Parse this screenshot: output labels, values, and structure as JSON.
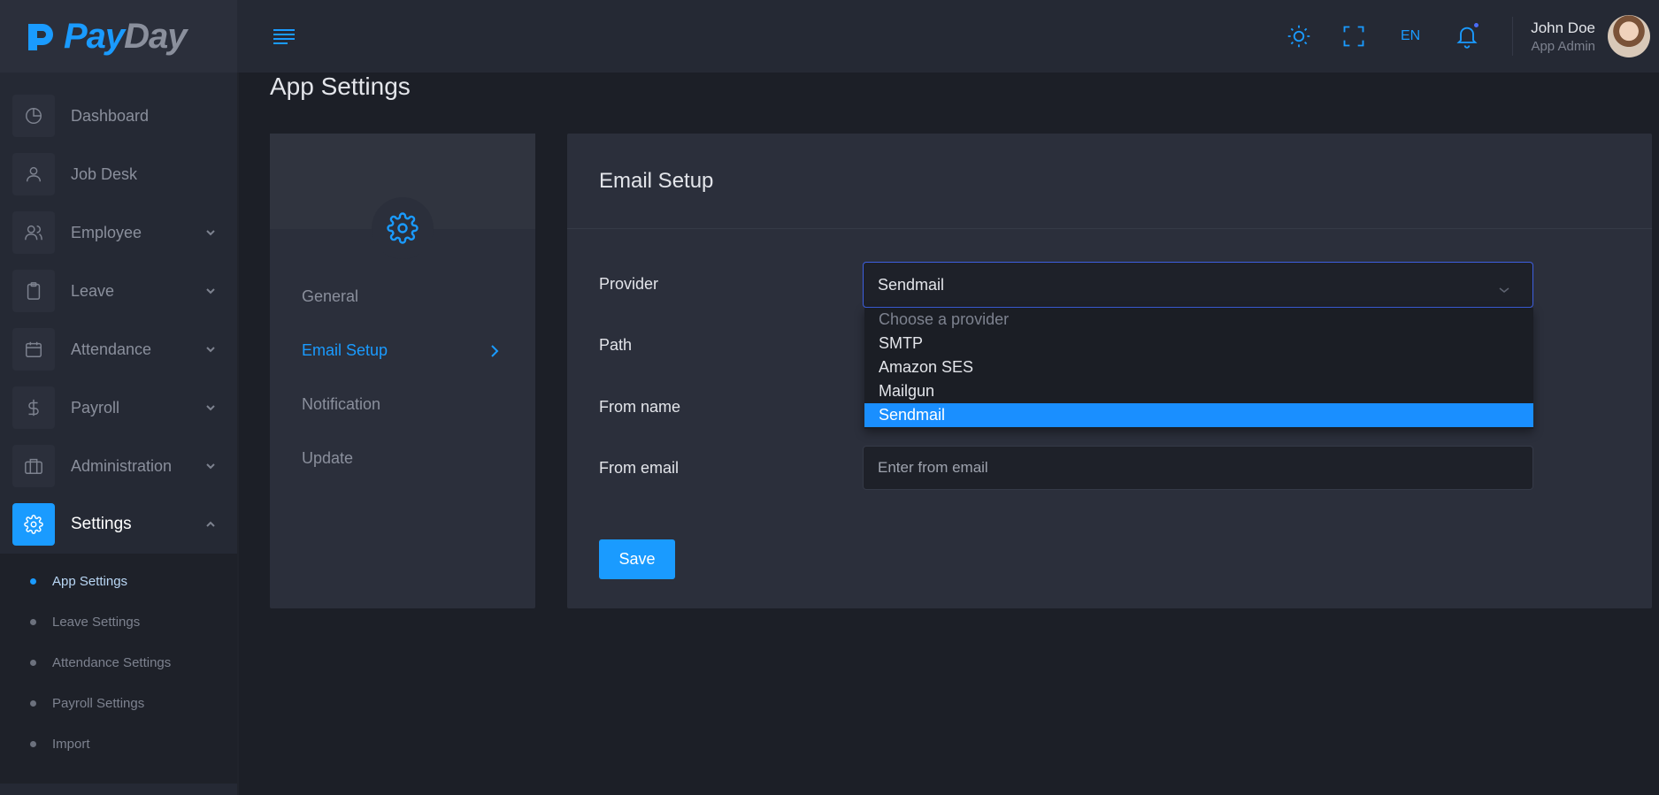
{
  "brand": {
    "pay": "Pay",
    "day": "Day"
  },
  "sidebar": {
    "items": [
      {
        "label": "Dashboard",
        "icon": "pie-chart-icon"
      },
      {
        "label": "Job Desk",
        "icon": "user-icon"
      },
      {
        "label": "Employee",
        "icon": "users-icon"
      },
      {
        "label": "Leave",
        "icon": "clipboard-icon"
      },
      {
        "label": "Attendance",
        "icon": "calendar-icon"
      },
      {
        "label": "Payroll",
        "icon": "dollar-icon"
      },
      {
        "label": "Administration",
        "icon": "briefcase-icon"
      },
      {
        "label": "Settings",
        "icon": "gear-icon"
      }
    ],
    "subitems": [
      {
        "label": "App Settings"
      },
      {
        "label": "Leave Settings"
      },
      {
        "label": "Attendance Settings"
      },
      {
        "label": "Payroll Settings"
      },
      {
        "label": "Import"
      }
    ]
  },
  "header": {
    "lang": "EN",
    "user_name": "John Doe",
    "user_role": "App Admin"
  },
  "page": {
    "title": "App Settings"
  },
  "settings_menu": {
    "items": [
      {
        "label": "General"
      },
      {
        "label": "Email Setup"
      },
      {
        "label": "Notification"
      },
      {
        "label": "Update"
      }
    ]
  },
  "panel": {
    "title": "Email Setup",
    "provider_label": "Provider",
    "provider_value": "Sendmail",
    "path_label": "Path",
    "from_name_label": "From name",
    "from_email_label": "From email",
    "from_email_placeholder": "Enter from email",
    "save_label": "Save",
    "options": [
      {
        "label": "Choose a provider"
      },
      {
        "label": "SMTP"
      },
      {
        "label": "Amazon SES"
      },
      {
        "label": "Mailgun"
      },
      {
        "label": "Sendmail"
      }
    ]
  },
  "colors": {
    "accent": "#1a9bff",
    "background": "#1c1f27",
    "card": "#2b2f3b"
  }
}
